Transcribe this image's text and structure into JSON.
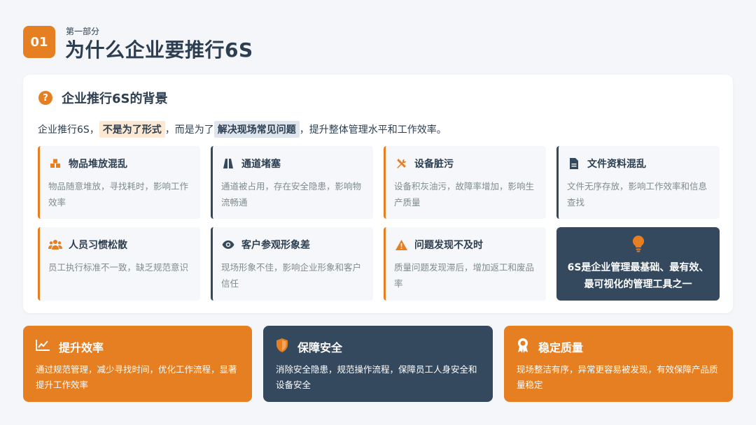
{
  "header": {
    "badge": "01",
    "subtitle": "第一部分",
    "title": "为什么企业要推行6S"
  },
  "panel": {
    "question_glyph": "?",
    "title": "企业推行6S的背景",
    "intro": {
      "part1": "企业推行6S，",
      "highlight1": "不是为了形式",
      "part2": "，而是为了",
      "highlight2": "解决现场常见问题",
      "part3": "，提升整体管理水平和工作效率。"
    },
    "cards": [
      {
        "title": "物品堆放混乱",
        "desc": "物品随意堆放，寻找耗时，影响工作效率",
        "icon": "boxes-icon",
        "border": "#e67e22"
      },
      {
        "title": "通道堵塞",
        "desc": "通道被占用，存在安全隐患，影响物流畅通",
        "icon": "road-icon",
        "border": "#34495e"
      },
      {
        "title": "设备脏污",
        "desc": "设备积灰油污，故障率增加，影响生产质量",
        "icon": "tools-icon",
        "border": "#e67e22"
      },
      {
        "title": "文件资料混乱",
        "desc": "文件无序存放，影响工作效率和信息查找",
        "icon": "file-icon",
        "border": "#34495e"
      },
      {
        "title": "人员习惯松散",
        "desc": "员工执行标准不一致，缺乏规范意识",
        "icon": "users-icon",
        "border": "#e67e22"
      },
      {
        "title": "客户参观形象差",
        "desc": "现场形象不佳，影响企业形象和客户信任",
        "icon": "eye-icon",
        "border": "#34495e"
      },
      {
        "title": "问题发现不及时",
        "desc": "质量问题发现滞后，增加返工和废品率",
        "icon": "warning-icon",
        "border": "#e67e22"
      }
    ],
    "feature": {
      "icon": "lightbulb-icon",
      "line1": "6S是企业管理最基础、最有效、",
      "line2": "最可视化的管理工具之一"
    }
  },
  "bottom_cards": [
    {
      "title": "提升效率",
      "desc": "通过规范管理，减少寻找时间，优化工作流程，显著提升工作效率",
      "icon": "chart-line-icon",
      "color": "#e67e22"
    },
    {
      "title": "保障安全",
      "desc": "消除安全隐患，规范操作流程，保障员工人身安全和设备安全",
      "icon": "shield-icon",
      "color": "#34495e"
    },
    {
      "title": "稳定质量",
      "desc": "现场整洁有序，异常更容易被发现，有效保障产品质量稳定",
      "icon": "award-icon",
      "color": "#e67e22"
    }
  ],
  "colors": {
    "accent": "#e67e22",
    "dark": "#34495e",
    "text": "#2c3e50",
    "muted": "#7f8c8d"
  }
}
